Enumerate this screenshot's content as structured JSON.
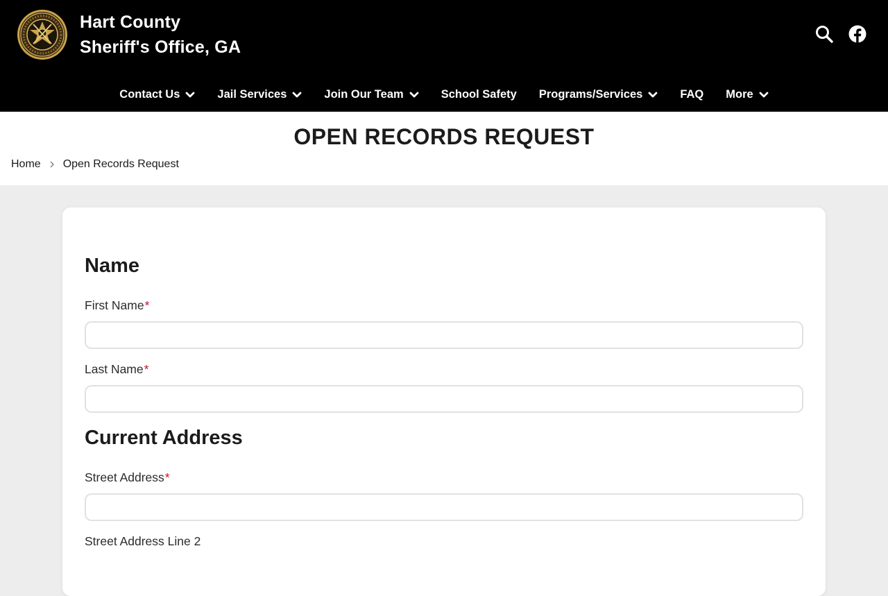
{
  "header": {
    "title_line1": "Hart County",
    "title_line2": "Sheriff's Office, GA",
    "logo_icon": "sheriff-seal-icon",
    "search_icon": "search-icon",
    "facebook_icon": "facebook-icon"
  },
  "nav": {
    "items": [
      {
        "label": "Contact Us",
        "dropdown": true
      },
      {
        "label": "Jail Services",
        "dropdown": true
      },
      {
        "label": "Join Our Team",
        "dropdown": true
      },
      {
        "label": "School Safety",
        "dropdown": false
      },
      {
        "label": "Programs/Services",
        "dropdown": true
      },
      {
        "label": "FAQ",
        "dropdown": false
      },
      {
        "label": "More",
        "dropdown": true
      }
    ]
  },
  "page": {
    "title": "OPEN RECORDS REQUEST",
    "breadcrumb": {
      "home": "Home",
      "current": "Open Records Request"
    }
  },
  "form": {
    "sections": {
      "name": "Name",
      "address": "Current Address"
    },
    "fields": {
      "first_name": {
        "label": "First Name",
        "value": "",
        "required_mark": "*"
      },
      "last_name": {
        "label": "Last Name",
        "value": "",
        "required_mark": "*"
      },
      "street_address": {
        "label": "Street Address",
        "value": "",
        "required_mark": "*"
      },
      "street_address_2": {
        "label": "Street Address Line 2",
        "value": ""
      }
    }
  },
  "colors": {
    "header_bg": "#000000",
    "page_bg": "#ededed",
    "required": "#c8102e",
    "seal_gold": "#b8923a"
  }
}
